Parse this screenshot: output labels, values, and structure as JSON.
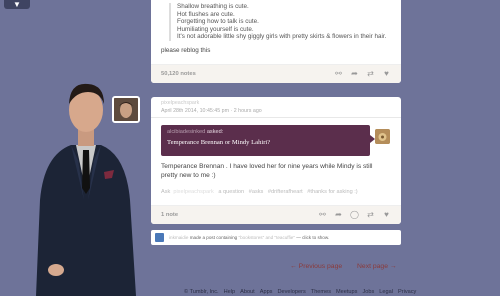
{
  "menu": {
    "toggle": "▼"
  },
  "post1": {
    "quote_lines": [
      "Shallow breathing is cute.",
      "Hot flushes are cute.",
      "Forgetting how to talk is cute.",
      "Humiliating yourself is cute."
    ],
    "quote_extra": "It's not adorable little shy giggly girls with pretty skirts & flowers in their hair.",
    "reblog_text": "please reblog this",
    "notes": "50,120 notes"
  },
  "post2": {
    "author": "pixelpeachspark",
    "date": "April 28th 2014, 10:45:45 pm",
    "ago": "· 2 hours ago",
    "asker": "alcibiadesinked",
    "asked_label": "asked:",
    "question": "Temperance Brennan or Mindy Lahiri?",
    "answer": "Temperance Brennan . I have loved her for nine years while Mindy is still pretty new to me :)",
    "tags_prefix": "Ask",
    "tags_blurred": "pixelpeachspark",
    "tags": [
      "a question",
      "#asks",
      "#drifterafheart",
      "#thanks for asking :)"
    ],
    "notes": "1 note"
  },
  "notification": {
    "user": "inkmaidie",
    "text1": "made a post containing",
    "blurred1": "\"bookstores\" and \"teacuffie\"",
    "text2": "— click to show."
  },
  "pager": {
    "prev": "← Previous page",
    "next": "Next page →"
  },
  "footer": {
    "links": [
      "© Tumblr, Inc.",
      "Help",
      "About",
      "Apps",
      "Developers",
      "Themes",
      "Meetups",
      "Jobs",
      "Legal",
      "Privacy"
    ]
  },
  "icons": [
    "reblog-off-icon",
    "share-icon",
    "chat-icon",
    "reblog-icon",
    "heart-icon"
  ],
  "colors": {
    "background": "#6e7399",
    "ask_bg": "#5b2e4c",
    "pager": "#8b3a3a"
  }
}
